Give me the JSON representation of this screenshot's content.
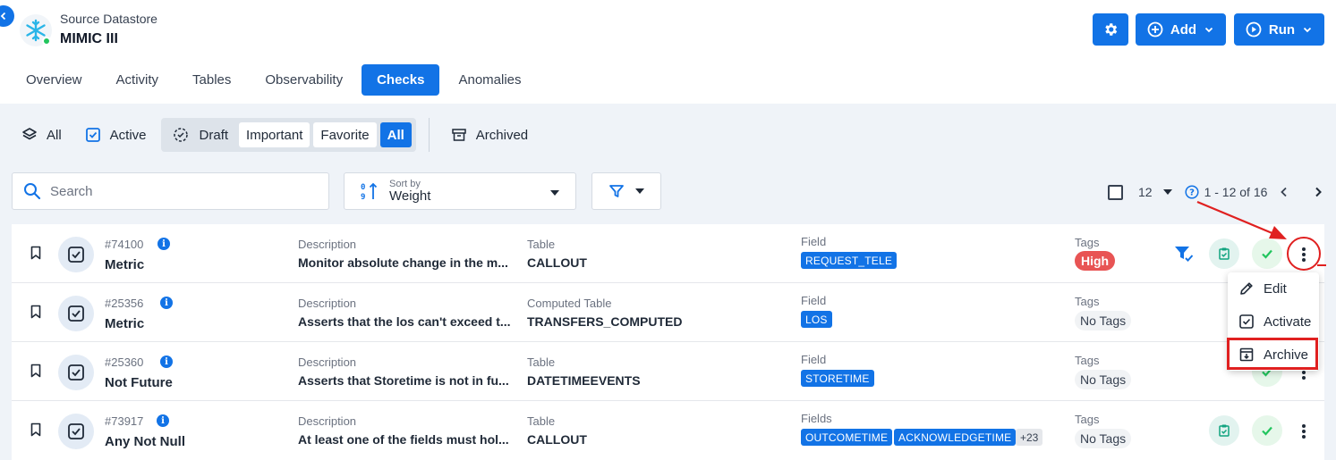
{
  "header": {
    "datastore_label": "Source Datastore",
    "datastore_name": "MIMIC III",
    "add_label": "Add",
    "run_label": "Run"
  },
  "tabs": [
    {
      "label": "Overview",
      "active": false
    },
    {
      "label": "Activity",
      "active": false
    },
    {
      "label": "Tables",
      "active": false
    },
    {
      "label": "Observability",
      "active": false
    },
    {
      "label": "Checks",
      "active": true
    },
    {
      "label": "Anomalies",
      "active": false
    }
  ],
  "filters": {
    "all": "All",
    "active": "Active",
    "draft": "Draft",
    "important": "Important",
    "favorite": "Favorite",
    "all_pill": "All",
    "archived": "Archived"
  },
  "search": {
    "placeholder": "Search"
  },
  "sort": {
    "small_label": "Sort by",
    "value": "Weight"
  },
  "pagination": {
    "per_page": "12",
    "range": "1 - 12 of 16"
  },
  "rows": [
    {
      "id": "#74100",
      "name": "Metric",
      "desc_label": "Description",
      "description": "Monitor absolute change in the m...",
      "table_label": "Table",
      "table": "CALLOUT",
      "field_label": "Field",
      "fields": [
        "REQUEST_TELE"
      ],
      "more": "",
      "tags_label": "Tags",
      "tag": "High"
    },
    {
      "id": "#25356",
      "name": "Metric",
      "desc_label": "Description",
      "description": "Asserts that the los can't exceed t...",
      "table_label": "Computed Table",
      "table": "TRANSFERS_COMPUTED",
      "field_label": "Field",
      "fields": [
        "LOS"
      ],
      "more": "",
      "tags_label": "Tags",
      "tag": "No Tags"
    },
    {
      "id": "#25360",
      "name": "Not Future",
      "desc_label": "Description",
      "description": "Asserts that Storetime is not in fu...",
      "table_label": "Table",
      "table": "DATETIMEEVENTS",
      "field_label": "Field",
      "fields": [
        "STORETIME"
      ],
      "more": "",
      "tags_label": "Tags",
      "tag": "No Tags"
    },
    {
      "id": "#73917",
      "name": "Any Not Null",
      "desc_label": "Description",
      "description": "At least one of the fields must hol...",
      "table_label": "Table",
      "table": "CALLOUT",
      "field_label": "Fields",
      "fields": [
        "OUTCOMETIME",
        "ACKNOWLEDGETIME"
      ],
      "more": "+23",
      "tags_label": "Tags",
      "tag": "No Tags"
    }
  ],
  "menu": {
    "edit": "Edit",
    "activate": "Activate",
    "archive": "Archive"
  },
  "colors": {
    "primary": "#1273e6",
    "high_tag": "#e85454",
    "annotation": "#e02020",
    "success": "#22c55e"
  }
}
